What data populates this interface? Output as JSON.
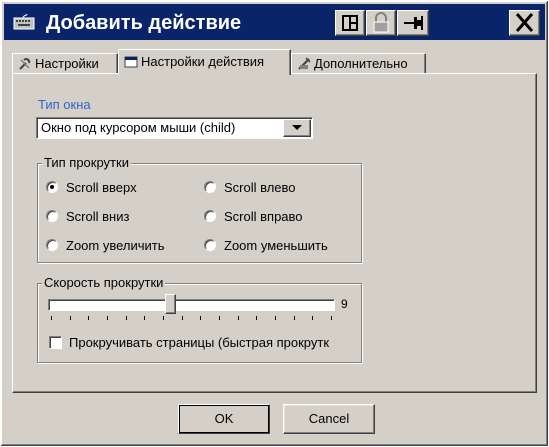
{
  "window": {
    "title": "Добавить действие"
  },
  "tabs": [
    {
      "label": "Настройки",
      "icon": "wrench-icon"
    },
    {
      "label": "Настройки действия",
      "icon": "window-icon",
      "active": true
    },
    {
      "label": "Дополнительно",
      "icon": "tools-icon"
    }
  ],
  "window_type": {
    "label": "Тип окна",
    "selected": "Окно под курсором мыши (child)"
  },
  "scroll_type": {
    "title": "Тип прокрутки",
    "options": [
      {
        "label": "Scroll вверх",
        "checked": true
      },
      {
        "label": "Scroll влево",
        "checked": false
      },
      {
        "label": "Scroll вниз",
        "checked": false
      },
      {
        "label": "Scroll вправо",
        "checked": false
      },
      {
        "label": "Zoom увеличить",
        "checked": false
      },
      {
        "label": "Zoom уменьшить",
        "checked": false
      }
    ]
  },
  "scroll_speed": {
    "title": "Скорость прокрутки",
    "value": "9",
    "position_fraction": 0.42,
    "page_scroll_label": "Прокручивать страницы (быстрая прокрутк",
    "page_scroll_checked": false
  },
  "buttons": {
    "ok": "OK",
    "cancel": "Cancel"
  },
  "colors": {
    "titlebar": "#0a246a",
    "accent_label": "#3164c9",
    "face": "#d4d0c8"
  }
}
